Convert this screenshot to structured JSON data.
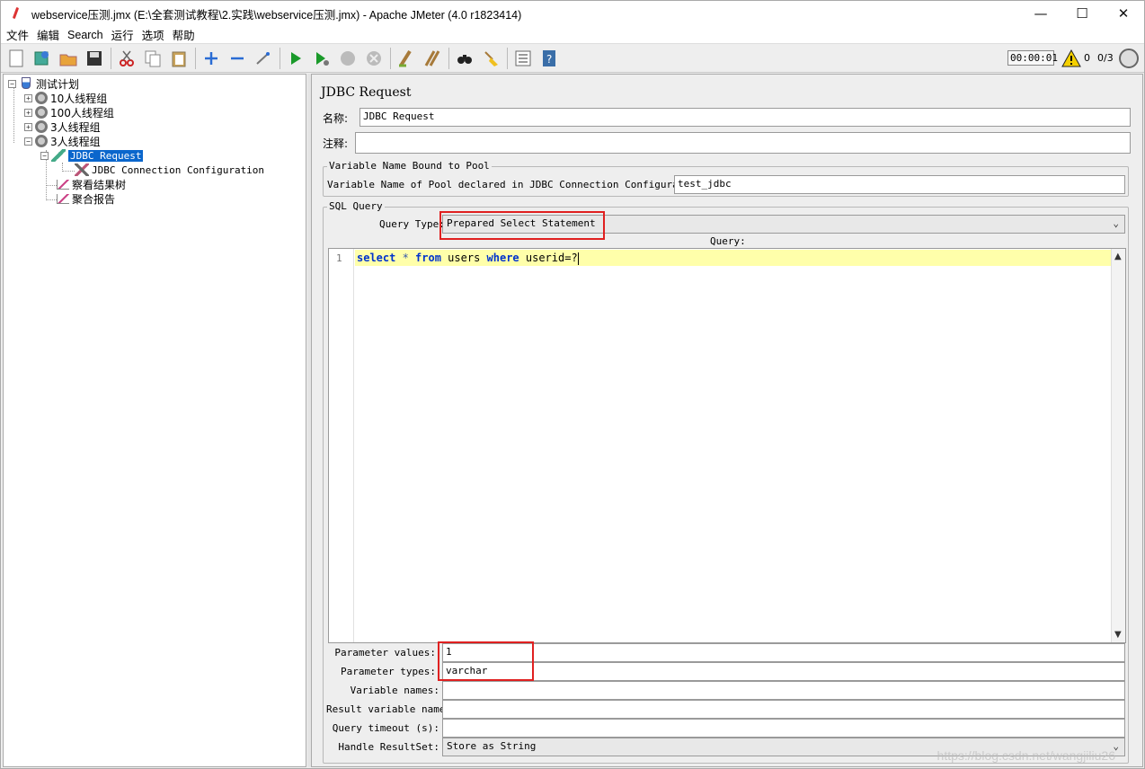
{
  "window": {
    "title": "webservice压测.jmx (E:\\全套测试教程\\2.实践\\webservice压测.jmx) - Apache JMeter (4.0 r1823414)",
    "minimize": "—",
    "maximize": "☐",
    "close": "✕"
  },
  "menu": [
    "文件",
    "编辑",
    "Search",
    "运行",
    "选项",
    "帮助"
  ],
  "toolbar": {
    "timer": "00:00:01",
    "warnings": "0",
    "threads": "0/3"
  },
  "tree": {
    "plan": "测试计划",
    "groups": [
      "10人线程组",
      "100人线程组",
      "3人线程组",
      "3人线程组"
    ],
    "selected": "JDBC Request",
    "child_config": "JDBC Connection Configuration",
    "listener1": "察看结果树",
    "listener2": "聚合报告"
  },
  "panel": {
    "title": "JDBC Request",
    "name_label": "名称:",
    "name_value": "JDBC Request",
    "comment_label": "注释:",
    "comment_value": "",
    "pool_group": "Variable Name Bound to Pool",
    "pool_label": "Variable Name of Pool declared in JDBC Connection Configuration:",
    "pool_value": "test_jdbc",
    "sql_group": "SQL Query",
    "query_type_label": "Query Type:",
    "query_type_value": "Prepared Select Statement",
    "query_label": "Query:",
    "line_number": "1",
    "sql_select": "select",
    "sql_star": " * ",
    "sql_from": "from",
    "sql_users": " users ",
    "sql_where": "where",
    "sql_rest": " userid=?",
    "param_values_label": "Parameter values:",
    "param_values": "1",
    "param_types_label": "Parameter types:",
    "param_types": "varchar",
    "var_names_label": "Variable names:",
    "var_names": "",
    "result_var_label": "Result variable name:",
    "result_var": "",
    "timeout_label": "Query timeout (s):",
    "timeout": "",
    "handle_label": "Handle ResultSet:",
    "handle_value": "Store as String"
  },
  "watermark": "https://blog.csdn.net/wangjiliu26",
  "colors": {
    "selection": "#0a66cc",
    "highlight_box": "#e02020",
    "code_line": "#ffffaa",
    "keyword": "#0033cc"
  }
}
